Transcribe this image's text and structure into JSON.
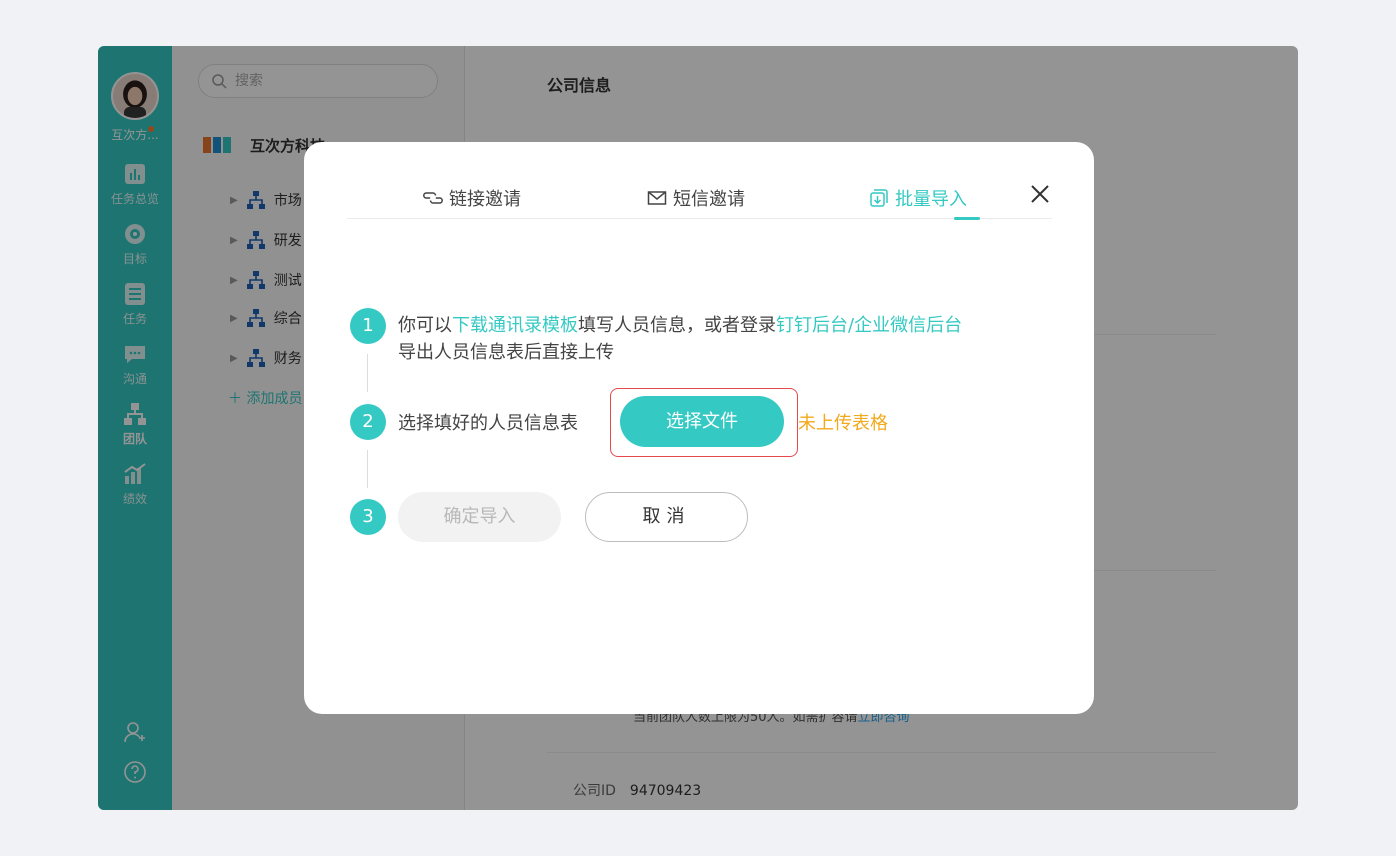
{
  "sidebar": {
    "user_name": "互次方...",
    "items": [
      {
        "label": "任务总览",
        "icon": "chart-icon"
      },
      {
        "label": "目标",
        "icon": "target-icon"
      },
      {
        "label": "任务",
        "icon": "list-icon"
      },
      {
        "label": "沟通",
        "icon": "chat-icon"
      },
      {
        "label": "团队",
        "icon": "org-icon"
      },
      {
        "label": "绩效",
        "icon": "growth-chart-icon"
      }
    ],
    "bottom_icons": [
      "add-user-icon",
      "help-icon"
    ]
  },
  "tree": {
    "search_placeholder": "搜索",
    "company_name": "互次方科技",
    "departments": [
      "市场",
      "研发",
      "测试",
      "综合",
      "财务"
    ],
    "add_member": "添加成员"
  },
  "main": {
    "title": "公司信息",
    "limit_text": "当前团队人数上限为50人。如需扩容请",
    "limit_link": "立即咨询",
    "company_id_label": "公司ID",
    "company_id_value": "94709423"
  },
  "modal": {
    "tabs": [
      {
        "label": "链接邀请",
        "icon": "link-icon"
      },
      {
        "label": "短信邀请",
        "icon": "mail-icon"
      },
      {
        "label": "批量导入",
        "icon": "import-icon",
        "active": true
      }
    ],
    "step1": {
      "num": "1",
      "text_a": "你可以",
      "link_a": "下载通讯录模板",
      "text_b": "填写人员信息，或者登录",
      "link_b": "钉钉后台/企业微信后台",
      "text_c": "导出人员信息表后直接上传"
    },
    "step2": {
      "num": "2",
      "text": "选择填好的人员信息表",
      "button": "选择文件",
      "status": "未上传表格"
    },
    "step3": {
      "num": "3",
      "confirm": "确定导入",
      "cancel": "取消"
    },
    "colors": {
      "accent": "#35c9c3",
      "warning": "#f2a91c",
      "highlight": "#e44a4a"
    }
  }
}
